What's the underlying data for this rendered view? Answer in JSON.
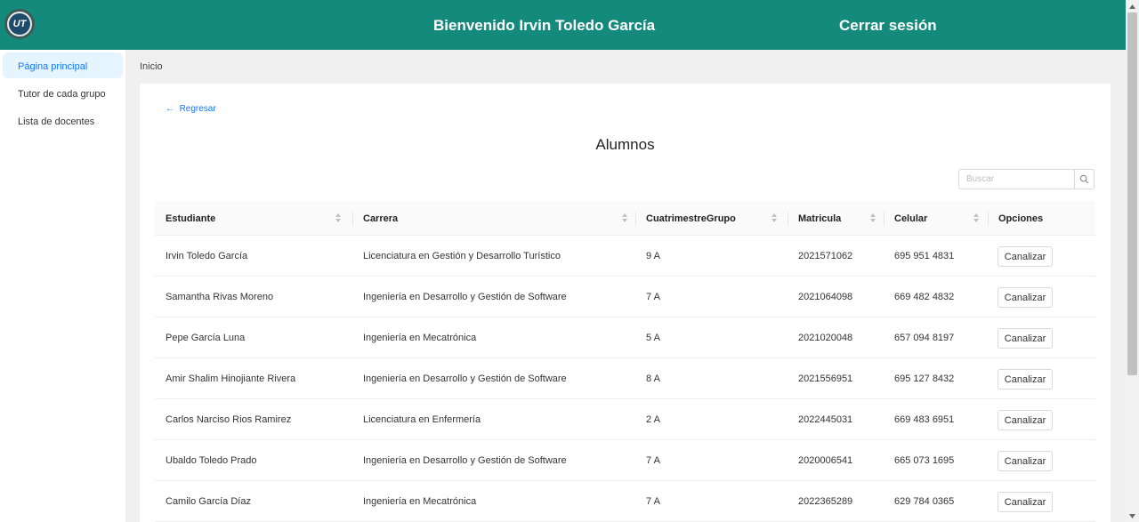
{
  "header": {
    "welcome": "Bienvenido Irvin Toledo García",
    "logout": "Cerrar sesión",
    "logo_text": "UT"
  },
  "sidebar": {
    "items": [
      {
        "label": "Página principal",
        "active": true
      },
      {
        "label": "Tutor de cada grupo",
        "active": false
      },
      {
        "label": "Lista de docentes",
        "active": false
      }
    ]
  },
  "breadcrumb": "Inicio",
  "page": {
    "back": "Regresar",
    "title": "Alumnos"
  },
  "search": {
    "placeholder": "Buscar",
    "value": ""
  },
  "table": {
    "headers": [
      "Estudiante",
      "Carrera",
      "CuatrimestreGrupo",
      "Matricula",
      "Celular",
      "Opciones"
    ],
    "rows": [
      [
        "Irvin Toledo García",
        "Licenciatura en Gestión y Desarrollo Turístico",
        "9 A",
        "2021571062",
        "695 951 4831"
      ],
      [
        "Samantha Rivas Moreno",
        "Ingeniería en Desarrollo y Gestión de Software",
        "7 A",
        "2021064098",
        "669 482 4832"
      ],
      [
        "Pepe García Luna",
        "Ingeniería en Mecatrónica",
        "5 A",
        "2021020048",
        "657 094 8197"
      ],
      [
        "Amir Shalim Hinojiante Rivera",
        "Ingeniería en Desarrollo y Gestión de Software",
        "8 A",
        "2021556951",
        "695 127 8432"
      ],
      [
        "Carlos Narciso Rios Ramirez",
        "Licenciatura en Enfermería",
        "2 A",
        "2022445031",
        "669 483 6951"
      ],
      [
        "Ubaldo Toledo Prado",
        "Ingeniería en Desarrollo y Gestión de Software",
        "7 A",
        "2020006541",
        "665 073 1695"
      ],
      [
        "Camilo García Díaz",
        "Ingeniería en Mecatrónica",
        "7 A",
        "2022365289",
        "629 784 0365"
      ]
    ],
    "action_label": "Canalizar"
  },
  "colors": {
    "header": "#138a7b",
    "accent": "#1677ff",
    "active_bg": "#e6f4ff"
  }
}
